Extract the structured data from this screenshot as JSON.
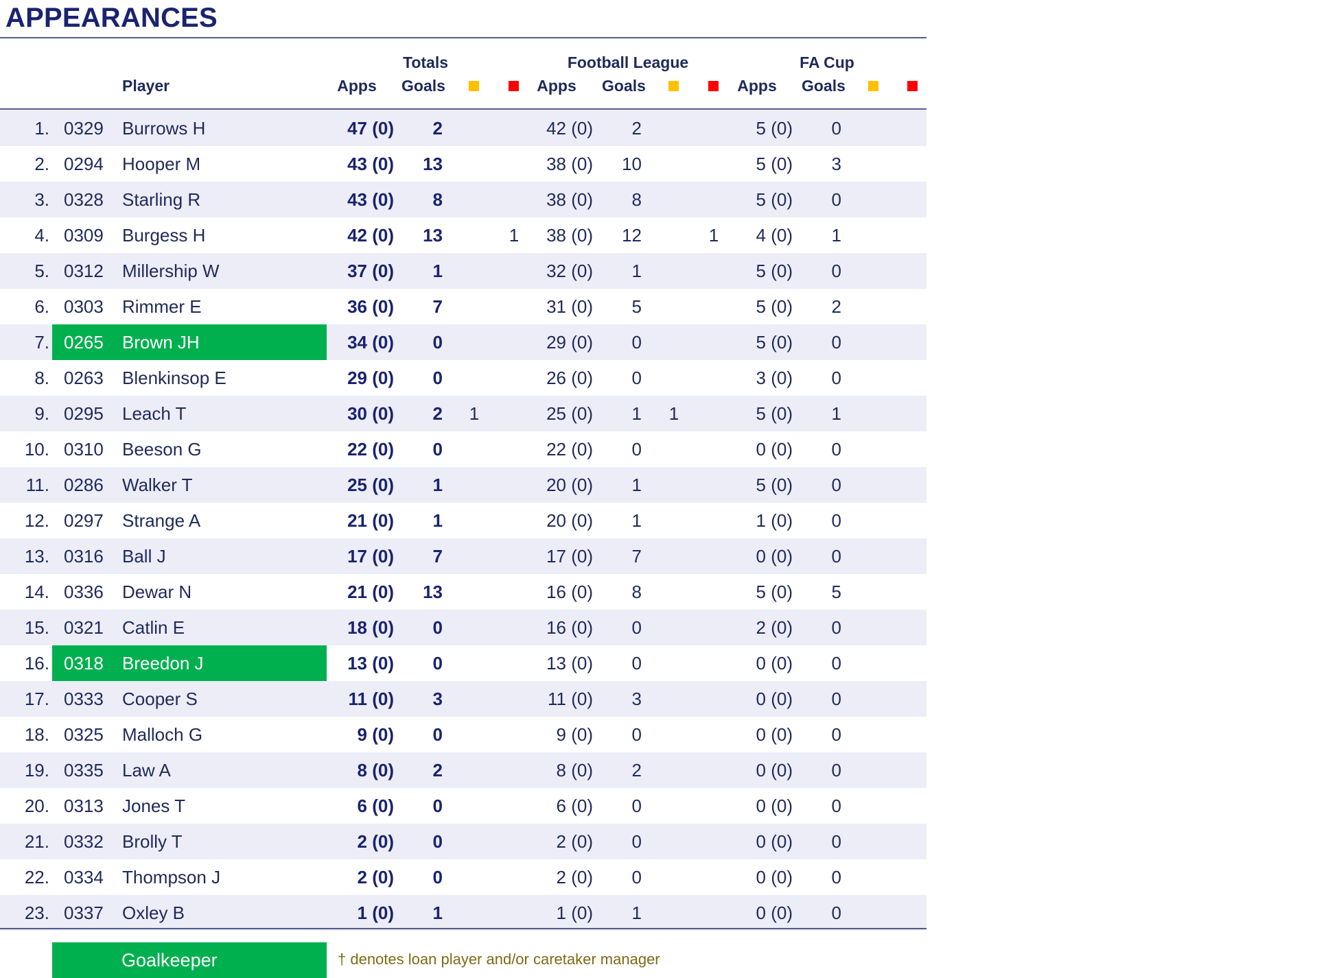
{
  "title": "APPEARANCES",
  "headers": {
    "player": "Player",
    "totals": "Totals",
    "football_league": "Football League",
    "fa_cup": "FA Cup",
    "apps": "Apps",
    "goals": "Goals"
  },
  "colors": {
    "yellow_card": "#ffc000",
    "red_card": "#ff0000",
    "goalkeeper": "#00b04f"
  },
  "rows": [
    {
      "pos": "1.",
      "id": "0329",
      "name": "Burrows H",
      "tot_apps": "47 (0)",
      "tot_goals": "2",
      "tot_y": "",
      "tot_r": "",
      "fl_apps": "42 (0)",
      "fl_goals": "2",
      "fl_y": "",
      "fl_r": "",
      "fa_apps": "5 (0)",
      "fa_goals": "0",
      "fa_y": "",
      "fa_r": "",
      "gk": false
    },
    {
      "pos": "2.",
      "id": "0294",
      "name": "Hooper M",
      "tot_apps": "43 (0)",
      "tot_goals": "13",
      "tot_y": "",
      "tot_r": "",
      "fl_apps": "38 (0)",
      "fl_goals": "10",
      "fl_y": "",
      "fl_r": "",
      "fa_apps": "5 (0)",
      "fa_goals": "3",
      "fa_y": "",
      "fa_r": "",
      "gk": false
    },
    {
      "pos": "3.",
      "id": "0328",
      "name": "Starling R",
      "tot_apps": "43 (0)",
      "tot_goals": "8",
      "tot_y": "",
      "tot_r": "",
      "fl_apps": "38 (0)",
      "fl_goals": "8",
      "fl_y": "",
      "fl_r": "",
      "fa_apps": "5 (0)",
      "fa_goals": "0",
      "fa_y": "",
      "fa_r": "",
      "gk": false
    },
    {
      "pos": "4.",
      "id": "0309",
      "name": "Burgess H",
      "tot_apps": "42 (0)",
      "tot_goals": "13",
      "tot_y": "",
      "tot_r": "1",
      "fl_apps": "38 (0)",
      "fl_goals": "12",
      "fl_y": "",
      "fl_r": "1",
      "fa_apps": "4 (0)",
      "fa_goals": "1",
      "fa_y": "",
      "fa_r": "",
      "gk": false
    },
    {
      "pos": "5.",
      "id": "0312",
      "name": "Millership W",
      "tot_apps": "37 (0)",
      "tot_goals": "1",
      "tot_y": "",
      "tot_r": "",
      "fl_apps": "32 (0)",
      "fl_goals": "1",
      "fl_y": "",
      "fl_r": "",
      "fa_apps": "5 (0)",
      "fa_goals": "0",
      "fa_y": "",
      "fa_r": "",
      "gk": false
    },
    {
      "pos": "6.",
      "id": "0303",
      "name": "Rimmer E",
      "tot_apps": "36 (0)",
      "tot_goals": "7",
      "tot_y": "",
      "tot_r": "",
      "fl_apps": "31 (0)",
      "fl_goals": "5",
      "fl_y": "",
      "fl_r": "",
      "fa_apps": "5 (0)",
      "fa_goals": "2",
      "fa_y": "",
      "fa_r": "",
      "gk": false
    },
    {
      "pos": "7.",
      "id": "0265",
      "name": "Brown JH",
      "tot_apps": "34 (0)",
      "tot_goals": "0",
      "tot_y": "",
      "tot_r": "",
      "fl_apps": "29 (0)",
      "fl_goals": "0",
      "fl_y": "",
      "fl_r": "",
      "fa_apps": "5 (0)",
      "fa_goals": "0",
      "fa_y": "",
      "fa_r": "",
      "gk": true
    },
    {
      "pos": "8.",
      "id": "0263",
      "name": "Blenkinsop E",
      "tot_apps": "29 (0)",
      "tot_goals": "0",
      "tot_y": "",
      "tot_r": "",
      "fl_apps": "26 (0)",
      "fl_goals": "0",
      "fl_y": "",
      "fl_r": "",
      "fa_apps": "3 (0)",
      "fa_goals": "0",
      "fa_y": "",
      "fa_r": "",
      "gk": false
    },
    {
      "pos": "9.",
      "id": "0295",
      "name": "Leach T",
      "tot_apps": "30 (0)",
      "tot_goals": "2",
      "tot_y": "1",
      "tot_r": "",
      "fl_apps": "25 (0)",
      "fl_goals": "1",
      "fl_y": "1",
      "fl_r": "",
      "fa_apps": "5 (0)",
      "fa_goals": "1",
      "fa_y": "",
      "fa_r": "",
      "gk": false
    },
    {
      "pos": "10.",
      "id": "0310",
      "name": "Beeson G",
      "tot_apps": "22 (0)",
      "tot_goals": "0",
      "tot_y": "",
      "tot_r": "",
      "fl_apps": "22 (0)",
      "fl_goals": "0",
      "fl_y": "",
      "fl_r": "",
      "fa_apps": "0 (0)",
      "fa_goals": "0",
      "fa_y": "",
      "fa_r": "",
      "gk": false
    },
    {
      "pos": "11.",
      "id": "0286",
      "name": "Walker T",
      "tot_apps": "25 (0)",
      "tot_goals": "1",
      "tot_y": "",
      "tot_r": "",
      "fl_apps": "20 (0)",
      "fl_goals": "1",
      "fl_y": "",
      "fl_r": "",
      "fa_apps": "5 (0)",
      "fa_goals": "0",
      "fa_y": "",
      "fa_r": "",
      "gk": false
    },
    {
      "pos": "12.",
      "id": "0297",
      "name": "Strange A",
      "tot_apps": "21 (0)",
      "tot_goals": "1",
      "tot_y": "",
      "tot_r": "",
      "fl_apps": "20 (0)",
      "fl_goals": "1",
      "fl_y": "",
      "fl_r": "",
      "fa_apps": "1 (0)",
      "fa_goals": "0",
      "fa_y": "",
      "fa_r": "",
      "gk": false
    },
    {
      "pos": "13.",
      "id": "0316",
      "name": "Ball J",
      "tot_apps": "17 (0)",
      "tot_goals": "7",
      "tot_y": "",
      "tot_r": "",
      "fl_apps": "17 (0)",
      "fl_goals": "7",
      "fl_y": "",
      "fl_r": "",
      "fa_apps": "0 (0)",
      "fa_goals": "0",
      "fa_y": "",
      "fa_r": "",
      "gk": false
    },
    {
      "pos": "14.",
      "id": "0336",
      "name": "Dewar N",
      "tot_apps": "21 (0)",
      "tot_goals": "13",
      "tot_y": "",
      "tot_r": "",
      "fl_apps": "16 (0)",
      "fl_goals": "8",
      "fl_y": "",
      "fl_r": "",
      "fa_apps": "5 (0)",
      "fa_goals": "5",
      "fa_y": "",
      "fa_r": "",
      "gk": false
    },
    {
      "pos": "15.",
      "id": "0321",
      "name": "Catlin E",
      "tot_apps": "18 (0)",
      "tot_goals": "0",
      "tot_y": "",
      "tot_r": "",
      "fl_apps": "16 (0)",
      "fl_goals": "0",
      "fl_y": "",
      "fl_r": "",
      "fa_apps": "2 (0)",
      "fa_goals": "0",
      "fa_y": "",
      "fa_r": "",
      "gk": false
    },
    {
      "pos": "16.",
      "id": "0318",
      "name": "Breedon J",
      "tot_apps": "13 (0)",
      "tot_goals": "0",
      "tot_y": "",
      "tot_r": "",
      "fl_apps": "13 (0)",
      "fl_goals": "0",
      "fl_y": "",
      "fl_r": "",
      "fa_apps": "0 (0)",
      "fa_goals": "0",
      "fa_y": "",
      "fa_r": "",
      "gk": true
    },
    {
      "pos": "17.",
      "id": "0333",
      "name": "Cooper S",
      "tot_apps": "11 (0)",
      "tot_goals": "3",
      "tot_y": "",
      "tot_r": "",
      "fl_apps": "11 (0)",
      "fl_goals": "3",
      "fl_y": "",
      "fl_r": "",
      "fa_apps": "0 (0)",
      "fa_goals": "0",
      "fa_y": "",
      "fa_r": "",
      "gk": false
    },
    {
      "pos": "18.",
      "id": "0325",
      "name": "Malloch G",
      "tot_apps": "9 (0)",
      "tot_goals": "0",
      "tot_y": "",
      "tot_r": "",
      "fl_apps": "9 (0)",
      "fl_goals": "0",
      "fl_y": "",
      "fl_r": "",
      "fa_apps": "0 (0)",
      "fa_goals": "0",
      "fa_y": "",
      "fa_r": "",
      "gk": false
    },
    {
      "pos": "19.",
      "id": "0335",
      "name": "Law A",
      "tot_apps": "8 (0)",
      "tot_goals": "2",
      "tot_y": "",
      "tot_r": "",
      "fl_apps": "8 (0)",
      "fl_goals": "2",
      "fl_y": "",
      "fl_r": "",
      "fa_apps": "0 (0)",
      "fa_goals": "0",
      "fa_y": "",
      "fa_r": "",
      "gk": false
    },
    {
      "pos": "20.",
      "id": "0313",
      "name": "Jones T",
      "tot_apps": "6 (0)",
      "tot_goals": "0",
      "tot_y": "",
      "tot_r": "",
      "fl_apps": "6 (0)",
      "fl_goals": "0",
      "fl_y": "",
      "fl_r": "",
      "fa_apps": "0 (0)",
      "fa_goals": "0",
      "fa_y": "",
      "fa_r": "",
      "gk": false
    },
    {
      "pos": "21.",
      "id": "0332",
      "name": "Brolly T",
      "tot_apps": "2 (0)",
      "tot_goals": "0",
      "tot_y": "",
      "tot_r": "",
      "fl_apps": "2 (0)",
      "fl_goals": "0",
      "fl_y": "",
      "fl_r": "",
      "fa_apps": "0 (0)",
      "fa_goals": "0",
      "fa_y": "",
      "fa_r": "",
      "gk": false
    },
    {
      "pos": "22.",
      "id": "0334",
      "name": "Thompson J",
      "tot_apps": "2 (0)",
      "tot_goals": "0",
      "tot_y": "",
      "tot_r": "",
      "fl_apps": "2 (0)",
      "fl_goals": "0",
      "fl_y": "",
      "fl_r": "",
      "fa_apps": "0 (0)",
      "fa_goals": "0",
      "fa_y": "",
      "fa_r": "",
      "gk": false
    },
    {
      "pos": "23.",
      "id": "0337",
      "name": "Oxley B",
      "tot_apps": "1 (0)",
      "tot_goals": "1",
      "tot_y": "",
      "tot_r": "",
      "fl_apps": "1 (0)",
      "fl_goals": "1",
      "fl_y": "",
      "fl_r": "",
      "fa_apps": "0 (0)",
      "fa_goals": "0",
      "fa_y": "",
      "fa_r": "",
      "gk": false
    }
  ],
  "legend": {
    "goalkeeper": "Goalkeeper",
    "note": "† denotes loan player and/or caretaker manager"
  }
}
